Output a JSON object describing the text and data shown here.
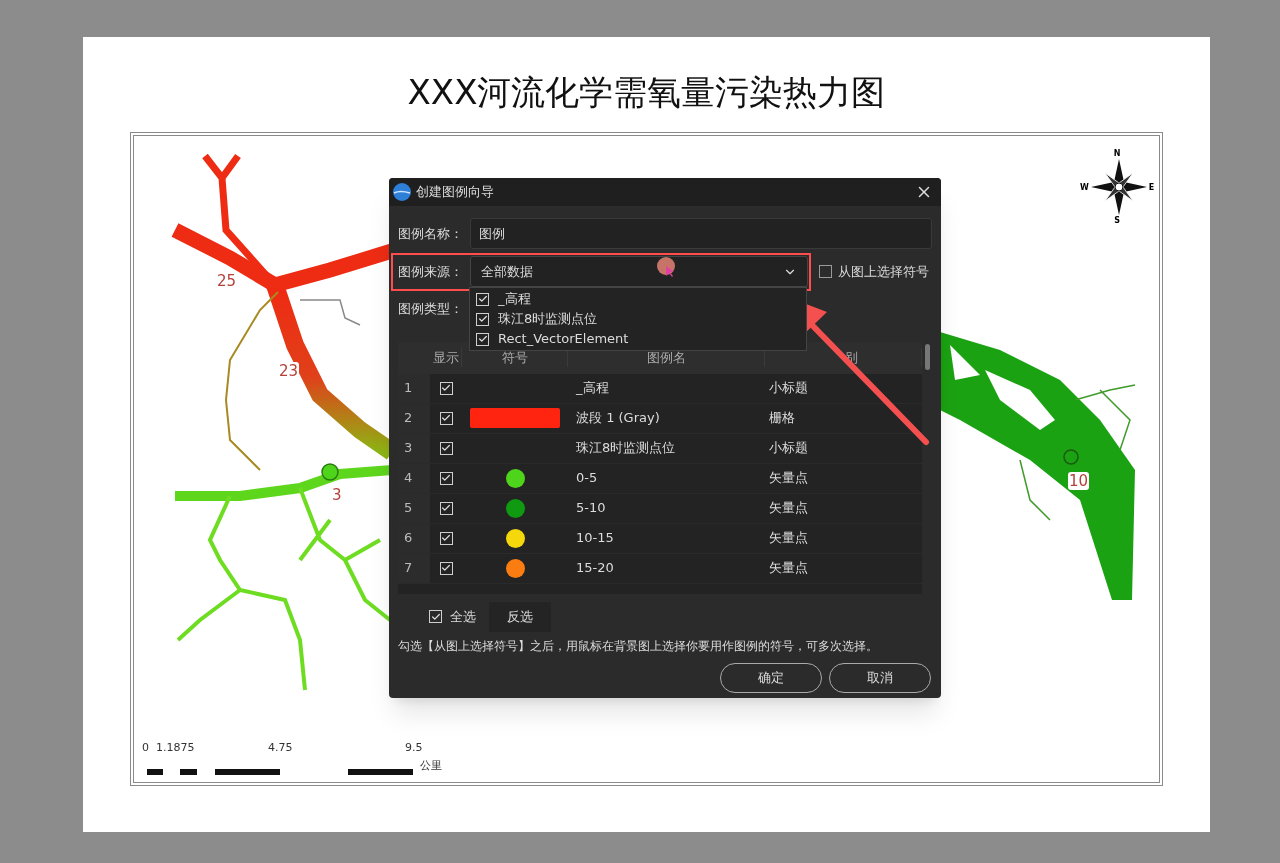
{
  "page_title": "XXX河流化学需氧量污染热力图",
  "map": {
    "point_labels": [
      "25",
      "23",
      "3",
      "10"
    ],
    "compass": {
      "n": "N",
      "e": "E",
      "s": "S",
      "w": "W"
    },
    "scale": {
      "ticks": [
        "0",
        "1.1875",
        "4.75",
        "9.5"
      ],
      "unit": "公里"
    }
  },
  "dialog": {
    "title": "创建图例向导",
    "name_label": "图例名称：",
    "name_value": "图例",
    "source_label": "图例来源：",
    "source_value": "全部数据",
    "pick_from_map": {
      "label": "从图上选择符号",
      "checked": false
    },
    "source_options": [
      {
        "label": "_高程",
        "checked": true
      },
      {
        "label": "珠江8时监测点位",
        "checked": true
      },
      {
        "label": "Rect_VectorElement",
        "checked": true
      }
    ],
    "type_label": "图例类型：",
    "columns": [
      "显示",
      "符号",
      "图例名",
      "别"
    ],
    "rows": [
      {
        "index": "1",
        "visible": true,
        "name": "_高程",
        "category": "小标题"
      },
      {
        "index": "2",
        "visible": true,
        "symbol": {
          "kind": "rect",
          "color": "#ff2410"
        },
        "name": "波段 1 (Gray)",
        "category": "栅格"
      },
      {
        "index": "3",
        "visible": true,
        "name": "珠江8时监测点位",
        "category": "小标题"
      },
      {
        "index": "4",
        "visible": true,
        "symbol": {
          "kind": "circle",
          "color": "#4fd41c"
        },
        "name": "0-5",
        "category": "矢量点"
      },
      {
        "index": "5",
        "visible": true,
        "symbol": {
          "kind": "circle",
          "color": "#0f9a12"
        },
        "name": "5-10",
        "category": "矢量点"
      },
      {
        "index": "6",
        "visible": true,
        "symbol": {
          "kind": "circle",
          "color": "#f5d80c"
        },
        "name": "10-15",
        "category": "矢量点"
      },
      {
        "index": "7",
        "visible": true,
        "symbol": {
          "kind": "circle",
          "color": "#fb7d12"
        },
        "name": "15-20",
        "category": "矢量点"
      }
    ],
    "select_all": {
      "label": "全选",
      "checked": true
    },
    "invert_button": "反选",
    "hint": "勾选【从图上选择符号】之后，用鼠标在背景图上选择你要用作图例的符号，可多次选择。",
    "buttons": [
      "确定",
      "取消"
    ]
  }
}
